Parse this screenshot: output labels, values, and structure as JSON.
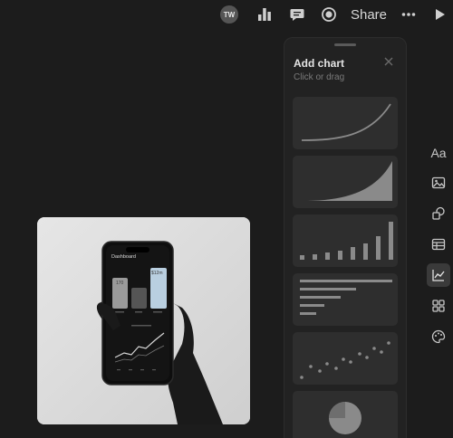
{
  "toolbar": {
    "avatar_initials": "TW",
    "share_label": "Share",
    "icons": [
      "analytics-icon",
      "comment-icon",
      "record-icon",
      "more-icon",
      "play-icon"
    ]
  },
  "panel": {
    "title": "Add chart",
    "subtitle": "Click or drag",
    "chart_options": [
      "curve-line",
      "area",
      "bar",
      "horizontal-bar",
      "scatter",
      "pie"
    ]
  },
  "rail": {
    "text_label": "Aa",
    "icons": [
      "text-icon",
      "image-icon",
      "shapes-icon",
      "table-icon",
      "chart-icon",
      "apps-icon",
      "palette-icon"
    ]
  },
  "photo": {
    "screen_title": "Dashboard",
    "bar_values": [
      "170",
      "$12m"
    ]
  },
  "colors": {
    "background": "#1c1c1c",
    "panel": "#222222",
    "card": "#2e2e2e",
    "active": "#3a3a3a"
  }
}
